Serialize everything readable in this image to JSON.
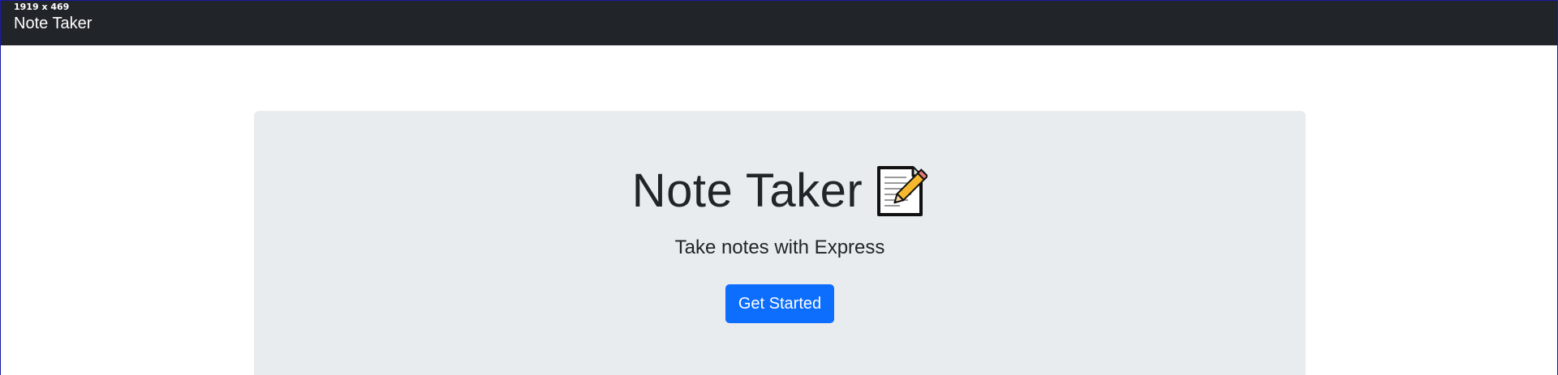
{
  "viewport_badge": "1919 x 469",
  "navbar": {
    "brand": "Note Taker"
  },
  "hero": {
    "title": "Note Taker",
    "title_icon": "memo-icon",
    "subtitle": "Take notes with Express",
    "cta_label": "Get Started"
  },
  "colors": {
    "navbar_bg": "#212529",
    "hero_bg": "#e9ecef",
    "primary": "#0d6efd",
    "text": "#212529"
  }
}
